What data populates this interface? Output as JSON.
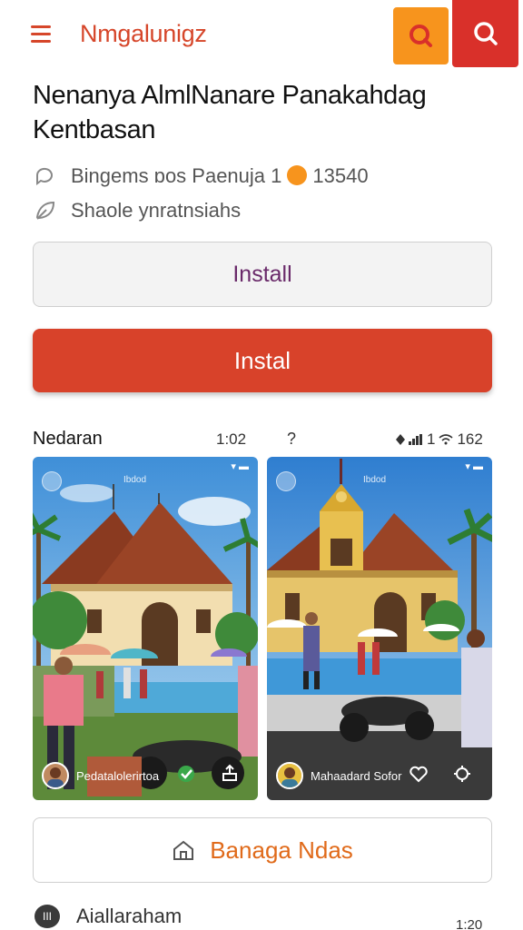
{
  "app": {
    "title": "Nmgalunigz",
    "accent": "#d6462a",
    "icons": [
      "menu-icon",
      "search-icon"
    ]
  },
  "headline": "Nenanya AlmlNanare Panakahdag Kentbasan",
  "meta": {
    "line1_prefix": "Bingems ɒos Paenuja 1",
    "line1_suffix": "13540",
    "line2": "Shaole ynratnsiahs"
  },
  "buttons": {
    "install_outline": "Install",
    "install_primary": "Instal",
    "secondary": "Banaga Ndas"
  },
  "gallery": {
    "label": "Nedaran",
    "time": "1:02",
    "question": "?",
    "status": "1",
    "status_time": "162",
    "shots": [
      {
        "top_label": "Ibdod",
        "credit": "Pedatalolerirtoa"
      },
      {
        "top_label": "Ibdod",
        "credit": "Mahaadard Sofor"
      }
    ]
  },
  "footer": {
    "label": "Aiallaraham",
    "icon_text": "III",
    "time": "1:20"
  }
}
